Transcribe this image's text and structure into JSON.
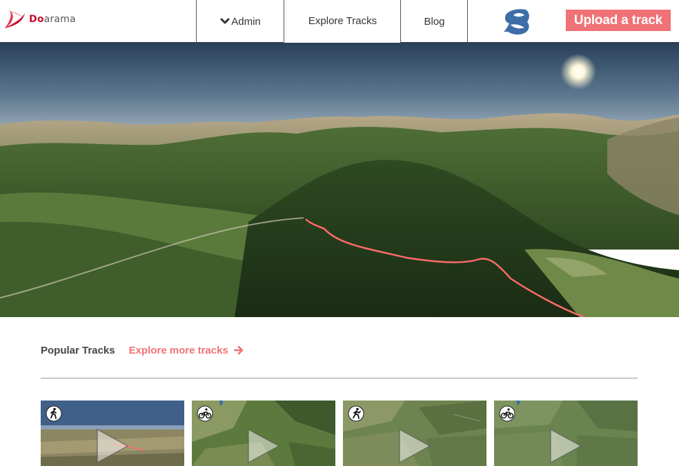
{
  "header": {
    "logo": {
      "brand_accent": "Do",
      "brand_rest": "arama"
    },
    "nav": {
      "admin_label": "Admin",
      "explore_label": "Explore Tracks",
      "blog_label": "Blog"
    },
    "upload_label": "Upload a track"
  },
  "colors": {
    "accent": "#f07176",
    "brand_red": "#c8102e",
    "avatar_blue": "#3d6ea8",
    "track_line": "#ff6b6b"
  },
  "popular": {
    "title": "Popular Tracks",
    "explore_more": "Explore more tracks"
  },
  "cards": [
    {
      "activity_icon": "walking-icon",
      "scene": "aerial-plain"
    },
    {
      "activity_icon": "cycling-icon",
      "scene": "satellite-forest"
    },
    {
      "activity_icon": "hiking-icon",
      "scene": "satellite-fields"
    },
    {
      "activity_icon": "cycling-icon",
      "scene": "satellite-farmland"
    }
  ]
}
